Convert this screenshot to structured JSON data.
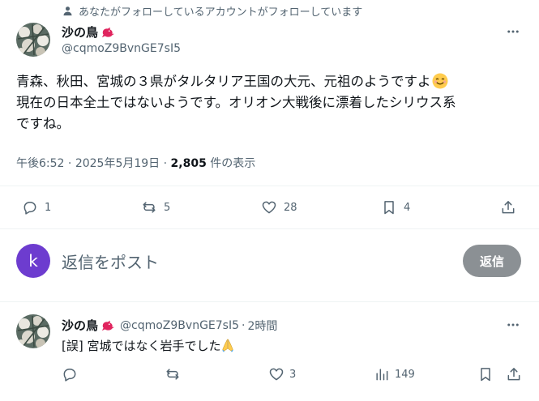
{
  "social_context": "あなたがフォローしているアカウントがフォローしています",
  "main_tweet": {
    "display_name": "沙の鳥",
    "handle": "@cqmoZ9BvnGE7sI5",
    "text_line1": "青森、秋田、宮城の３県がタルタリア王国の大元、元祖のようですよ",
    "text_line2": "現在の日本全土ではないようです。オリオン大戦後に漂着したシリウス系",
    "text_line3": "ですね。",
    "time": "午後6:52",
    "separator": "·",
    "date": "2025年5月19日",
    "views_count": "2,805",
    "views_label": "件の表示",
    "stats": {
      "replies": "1",
      "retweets": "5",
      "likes": "28",
      "bookmarks": "4"
    }
  },
  "reply_composer": {
    "avatar_letter": "k",
    "placeholder": "返信をポスト",
    "button_label": "返信"
  },
  "reply_tweet": {
    "display_name": "沙の鳥",
    "handle": "@cqmoZ9BvnGE7sI5",
    "separator": "·",
    "time": "2時間",
    "text": "[誤] 宮城ではなく岩手でした",
    "stats": {
      "replies": "",
      "retweets": "",
      "likes": "3",
      "views": "149"
    }
  },
  "icons": {
    "social_context": "person-icon",
    "badge": "red-bird-icon",
    "more": "more-icon",
    "reply": "reply-icon",
    "retweet": "retweet-icon",
    "like": "heart-icon",
    "bookmark": "bookmark-icon",
    "share": "share-icon",
    "views": "views-icon"
  },
  "colors": {
    "text": "#0f1419",
    "secondary": "#536471",
    "divider": "#eff3f4",
    "avatar_k": "#6d3ccf",
    "reply_button": "#8b9094",
    "bird_badge": "#e0245e"
  }
}
